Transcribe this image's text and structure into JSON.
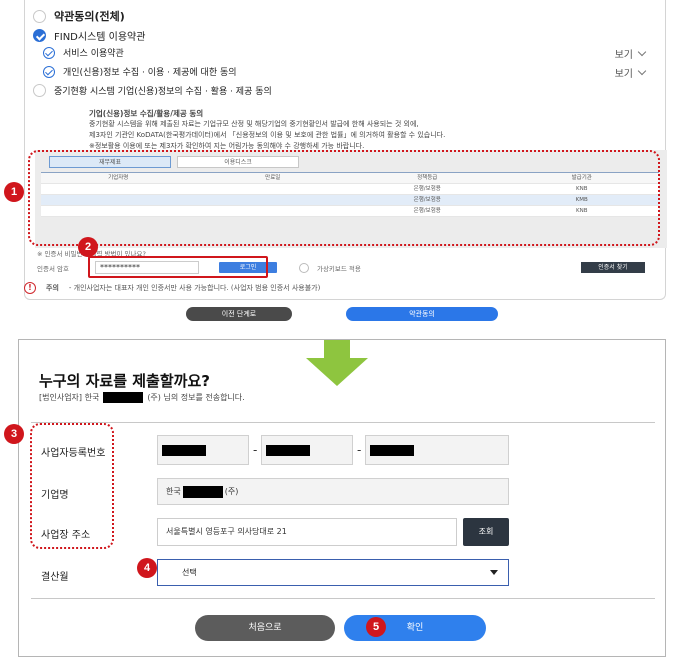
{
  "top": {
    "all_agree": "약관동의(전체)",
    "find_terms": "FIND시스템 이용약관",
    "service_terms": "서비스 이용약관",
    "personal_info_terms": "개인(신용)정보 수집 · 이용 · 제공에 대한 동의",
    "sme_terms": "중기현황 시스템 기업(신용)정보의 수집 · 활용 · 제공 동의",
    "view_label": "보기",
    "info_title": "기업(신용)정보 수집/활용/제공 동의",
    "info_lines": [
      "중기현황 시스템을 위해 제출된 자료는 기업규모 산정 및 해당기업의 중기현황인서 발급에 한해 사용되는 것 외에,",
      "제3자인 기관인 KoDATA(한국평가데이터)에서 「신용정보의 이용 및 보호에 관한 법률」에 의거하여 활용할 수 있습니다.",
      "※정보활용 이용에 또는 제3자가 확인하여 지는 어림가능 동의해야 수 강행하세 가능 바랍니다."
    ],
    "tabs": [
      "재무제표",
      "이용디스크"
    ],
    "table": {
      "headers": [
        "기업자명",
        "만료일",
        "정책등급",
        "발급기관"
      ],
      "rows": [
        [
          "",
          "",
          "은행/보험용",
          "KNB"
        ],
        [
          "",
          "",
          "은행/보험용",
          "KMB"
        ],
        [
          "",
          "",
          "은행/보험용",
          "KNB"
        ]
      ]
    },
    "notice_line": "※ 인증서 비밀번호 입력 방법이 있나요?",
    "pw_label": "인증서 암호",
    "pw_value": "**********",
    "pw_button": "로그인",
    "radio_label": "가상키보드 적용",
    "dark_button": "인증서 찾기",
    "caution_label": "주의",
    "caution_text": "- 개인사업자는 대표자 개인 인증서만 사용 가능합니다. (사업자 범용 인증서 사용불가)",
    "prev_button": "이전 단계로",
    "agree_button": "약관동의"
  },
  "badges": [
    "1",
    "2",
    "3",
    "4",
    "5"
  ],
  "modal": {
    "title": "누구의 자료를 제출할까요?",
    "sub_prefix": "[법인사업자] 한국",
    "sub_suffix": "(주)  님의 정보를 전송합니다.",
    "label_bizno": "사업자등록번호",
    "label_company": "기업명",
    "label_address": "사업장 주소",
    "label_closing": "결산월",
    "company_prefix": "한국",
    "company_suffix": "(주)",
    "address_value": "서울특별시 영등포구 의사당대로 21",
    "search_button": "조회",
    "closing_value": "선택",
    "first_button": "처음으로",
    "confirm_button": "확인"
  },
  "colors": {
    "accent_red": "#d0161c",
    "primary_blue": "#2f80ed",
    "arrow_green": "#8ec53f"
  }
}
